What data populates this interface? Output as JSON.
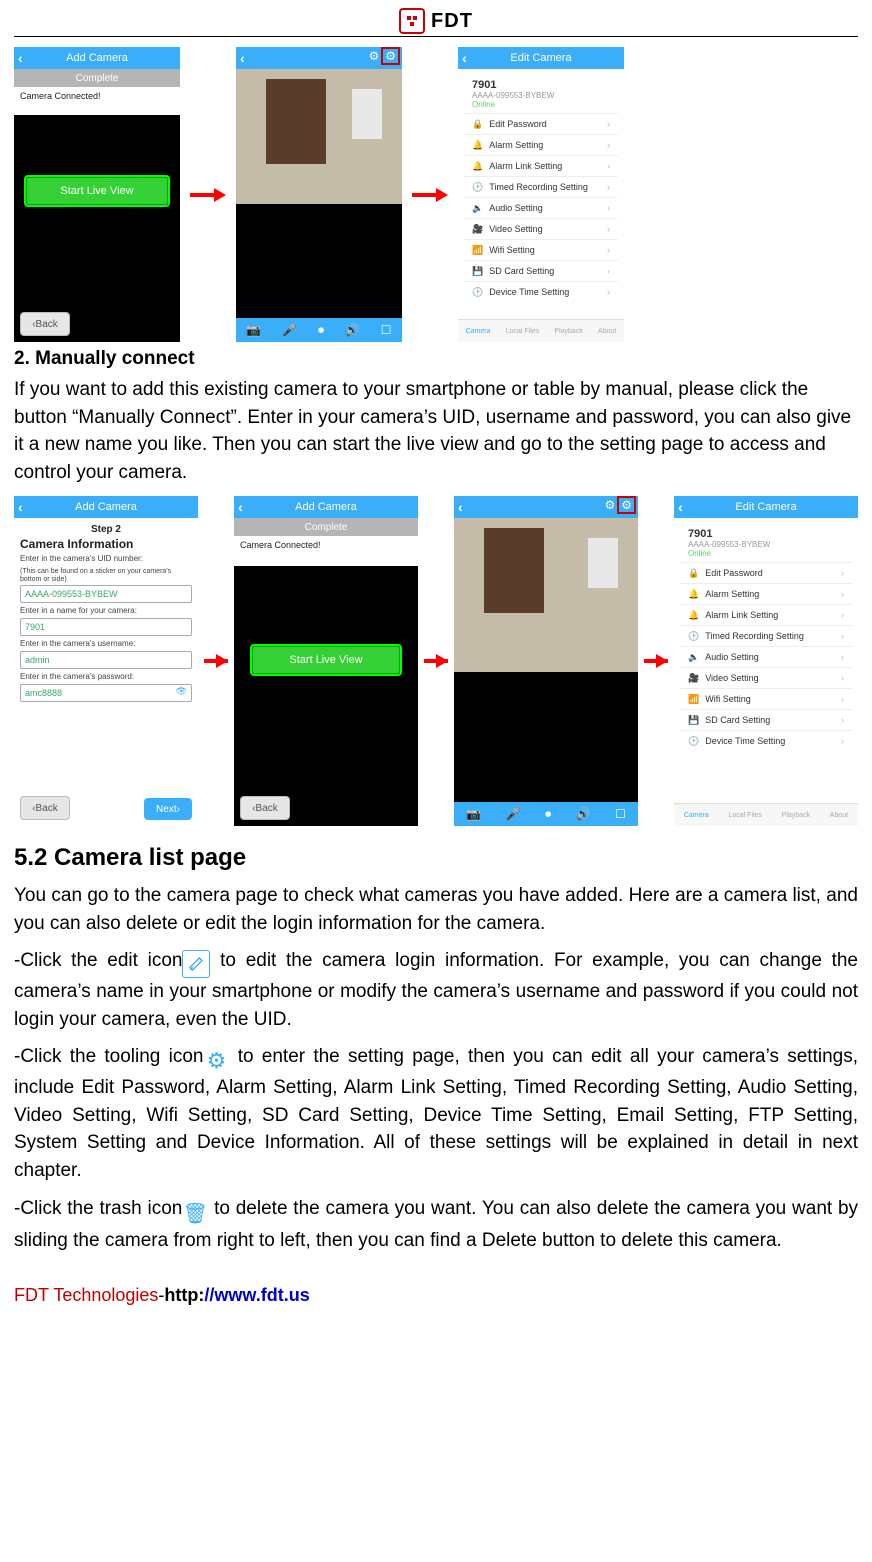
{
  "header": {
    "brand": "FDT"
  },
  "section_manual": {
    "title": "2. Manually connect",
    "para": "If you want to add this existing camera to your smartphone or table by manual, please click the button “Manually Connect”. Enter in your camera’s UID, username and password, you can also give it a new name you like. Then you can start the live view and go to the setting page to access and control your camera."
  },
  "section_52": {
    "title": "5.2 Camera list page",
    "para1": "You can go to the camera page to check what cameras you have added. Here are a camera list, and you can also delete or edit the login information for the camera.",
    "edit_pre": "-Click the edit icon",
    "edit_post": " to edit the camera login information. For example, you can change the camera’s name in your smartphone or modify the camera’s username and password if you could not login your camera, even the UID.",
    "tool_pre": "-Click the tooling icon",
    "tool_post": " to enter the setting page, then you can edit all your camera’s settings, include Edit Password, Alarm Setting, Alarm Link Setting, Timed Recording Setting, Audio Setting, Video Setting, Wifi Setting, SD Card Setting, Device Time Setting, Email Setting, FTP Setting, System Setting and Device Information. All of these settings will be explained in detail in next chapter.",
    "trash_pre": "-Click the trash icon",
    "trash_post": " to delete the camera you want. You can also delete the camera you want by sliding the camera from right to left, then you can find a Delete button to delete this camera."
  },
  "footer": {
    "company": "FDT Technologies",
    "dash": "-",
    "http": "http:",
    "url": "//www.fdt.us"
  },
  "screens": {
    "add_camera_title": "Add Camera",
    "edit_camera_title": "Edit Camera",
    "complete": "Complete",
    "connected": "Camera Connected!",
    "start_live": "Start Live View",
    "back": "Back",
    "next": "Next",
    "step2": "Step 2",
    "cam_info": "Camera Information",
    "uid_prompt": "Enter in the camera's UID number:",
    "uid_note": "(This can be found on a sticker on your camera's bottom or side)",
    "uid_value": "AAAA-099553-BYBEW",
    "name_prompt": "Enter in a name for your camera:",
    "name_value": "7901",
    "user_prompt": "Enter in the camera's username:",
    "user_value": "admin",
    "pass_prompt": "Enter in the camera's password:",
    "pass_value": "amc8888",
    "device_name": "7901",
    "device_uid": "AAAA-099553-BYBEW",
    "device_status": "Online",
    "settings": [
      "Edit Password",
      "Alarm Setting",
      "Alarm Link Setting",
      "Timed Recording Setting",
      "Audio Setting",
      "Video Setting",
      "Wifi Setting",
      "SD Card Setting",
      "Device Time Setting"
    ],
    "nav": [
      "Camera",
      "Local Files",
      "Playback",
      "About"
    ]
  },
  "icons": {
    "edit": "✉",
    "gear": "⚙",
    "trash": "🗑"
  }
}
